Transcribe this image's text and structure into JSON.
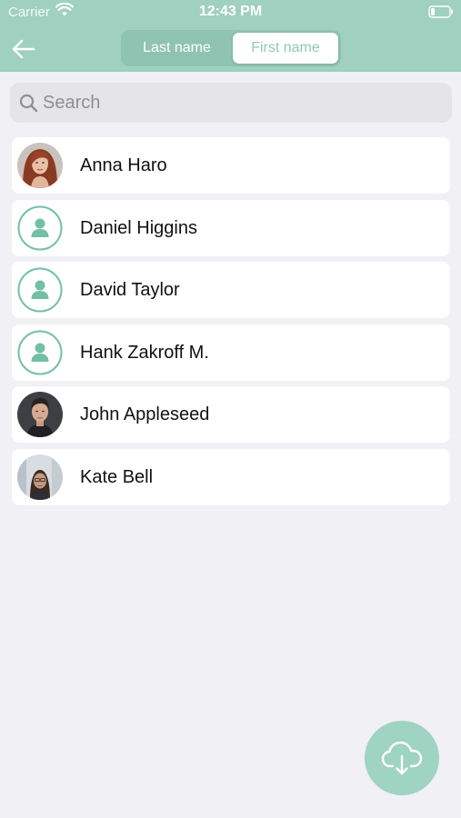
{
  "status_bar": {
    "carrier": "Carrier",
    "time": "12:43 PM"
  },
  "header": {
    "segments": [
      {
        "label": "Last name",
        "selected": false
      },
      {
        "label": "First name",
        "selected": true
      }
    ]
  },
  "search": {
    "placeholder": "Search",
    "value": ""
  },
  "contacts": [
    {
      "name": "Anna Haro",
      "avatar": "photo-woman-red-hair"
    },
    {
      "name": "Daniel Higgins",
      "avatar": "person-placeholder-icon"
    },
    {
      "name": "David Taylor",
      "avatar": "person-placeholder-icon"
    },
    {
      "name": "Hank Zakroff M.",
      "avatar": "person-placeholder-icon"
    },
    {
      "name": "John Appleseed",
      "avatar": "photo-man-dark-hair"
    },
    {
      "name": "Kate Bell",
      "avatar": "photo-woman-glasses"
    }
  ],
  "fab": {
    "icon": "cloud-download-icon"
  },
  "colors": {
    "accent": "#9fd0c0",
    "accent_dark": "#8fc3b2",
    "placeholder_ring": "#72c0a6",
    "background": "#f0f0f5"
  }
}
